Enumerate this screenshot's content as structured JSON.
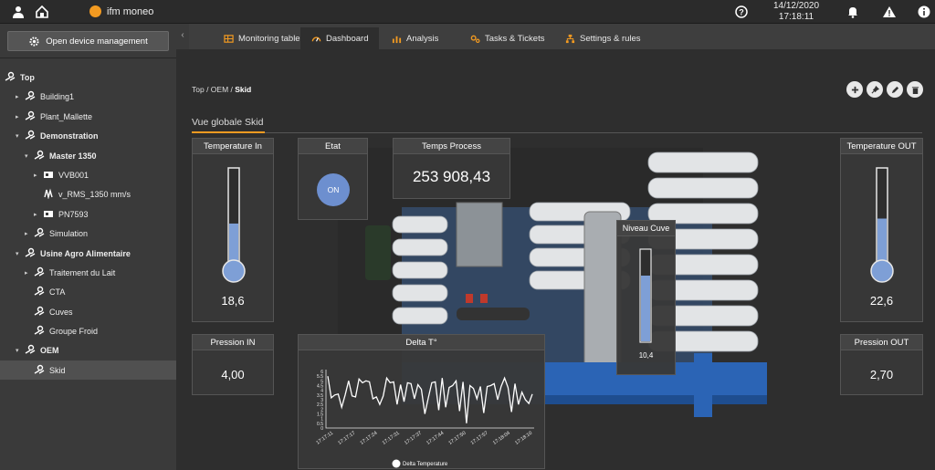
{
  "topbar": {
    "app_name": "ifm moneo",
    "date": "14/12/2020",
    "time": "17:18:11",
    "logo_color": "#f29a21"
  },
  "sidebar": {
    "device_button": "Open device management",
    "tree": [
      {
        "label": "Top",
        "level": 0,
        "caret": "",
        "bold": true,
        "icon": "sensor-group-icon"
      },
      {
        "label": "Building1",
        "level": 1,
        "caret": "▸",
        "bold": false,
        "icon": "sensor-group-icon"
      },
      {
        "label": "Plant_Mallette",
        "level": 1,
        "caret": "▸",
        "bold": false,
        "icon": "sensor-group-icon"
      },
      {
        "label": "Demonstration",
        "level": 1,
        "caret": "▾",
        "bold": true,
        "icon": "sensor-group-icon"
      },
      {
        "label": "Master 1350",
        "level": 2,
        "caret": "▾",
        "bold": true,
        "icon": "sensor-group-icon"
      },
      {
        "label": "VVB001",
        "level": 3,
        "caret": "▸",
        "bold": false,
        "icon": "device-icon"
      },
      {
        "label": "v_RMS_1350 mm/s",
        "level": 3,
        "caret": "",
        "bold": false,
        "icon": "vibration-icon"
      },
      {
        "label": "PN7593",
        "level": 3,
        "caret": "▸",
        "bold": false,
        "icon": "device-icon"
      },
      {
        "label": "Simulation",
        "level": 2,
        "caret": "▸",
        "bold": false,
        "icon": "sensor-group-icon"
      },
      {
        "label": "Usine Agro Alimentaire",
        "level": 1,
        "caret": "▾",
        "bold": true,
        "icon": "sensor-group-icon"
      },
      {
        "label": "Traitement du Lait",
        "level": 2,
        "caret": "▸",
        "bold": false,
        "icon": "sensor-group-icon"
      },
      {
        "label": "CTA",
        "level": 2,
        "caret": "",
        "bold": false,
        "icon": "sensor-group-icon"
      },
      {
        "label": "Cuves",
        "level": 2,
        "caret": "",
        "bold": false,
        "icon": "sensor-group-icon"
      },
      {
        "label": "Groupe Froid",
        "level": 2,
        "caret": "",
        "bold": false,
        "icon": "sensor-group-icon"
      },
      {
        "label": "OEM",
        "level": 1,
        "caret": "▾",
        "bold": true,
        "icon": "sensor-group-icon"
      },
      {
        "label": "Skid",
        "level": 2,
        "caret": "",
        "bold": false,
        "icon": "sensor-group-icon",
        "selected": true
      }
    ]
  },
  "tabs": [
    {
      "label": "Monitoring table",
      "icon": "table-icon",
      "active": false
    },
    {
      "label": "Dashboard",
      "icon": "gauge-icon",
      "active": true
    },
    {
      "label": "Analysis",
      "icon": "bar-chart-icon",
      "active": false
    },
    {
      "label": "Tasks & Tickets",
      "icon": "gears-icon",
      "active": false
    },
    {
      "label": "Settings & rules",
      "icon": "network-icon",
      "active": false
    }
  ],
  "breadcrumb": {
    "path": "Top / OEM / ",
    "current": "Skid"
  },
  "dashboard_title": "Vue globale Skid",
  "widgets": {
    "temp_in": {
      "title": "Temperature In",
      "value": "18,6",
      "level": 0.45
    },
    "etat": {
      "title": "Etat",
      "value": "ON",
      "color": "#6d8fcf"
    },
    "temps": {
      "title": "Temps Process",
      "value": "253 908,43"
    },
    "niveau": {
      "title": "Niveau Cuve",
      "value": "10,4",
      "level": 0.72
    },
    "temp_out": {
      "title": "Temperature OUT",
      "value": "22,6",
      "level": 0.5
    },
    "pression_in": {
      "title": "Pression IN",
      "value": "4,00"
    },
    "pression_out": {
      "title": "Pression OUT",
      "value": "2,70"
    },
    "delta": {
      "title": "Delta T°"
    }
  },
  "chart_data": {
    "type": "line",
    "title": "Delta T°",
    "x": [
      "17:17:11",
      "17:17:17",
      "17:17:24",
      "17:17:31",
      "17:17:37",
      "17:17:44",
      "17:17:50",
      "17:17:57",
      "17:18:04",
      "17:18:10"
    ],
    "yticks": [
      "0",
      "0.5",
      "1",
      "1.5",
      "2",
      "2.5",
      "3",
      "3.5",
      "4",
      "4.5",
      "5",
      "5.5",
      "6"
    ],
    "ylim": [
      0,
      6
    ],
    "series": [
      {
        "name": "Delta Temperature",
        "color": "#ffffff",
        "values": [
          5.5,
          3.2,
          3.5,
          3.6,
          2.2,
          3.5,
          5.0,
          3.4,
          3.3,
          5.2,
          4.8,
          5.0,
          4.9,
          3.1,
          3.3,
          2.5,
          3.4,
          5.3,
          4.8,
          4.9,
          2.5,
          4.6,
          2.8,
          4.8,
          4.7,
          3.1,
          4.6,
          4.1,
          1.5,
          3.2,
          4.8,
          4.9,
          1.9,
          5.3,
          2.2,
          4.3,
          4.5,
          5.0,
          1.8,
          4.9,
          0.5,
          4.5,
          4.2,
          3.1,
          4.4,
          1.6,
          4.4,
          4.5,
          4.7,
          3.0,
          4.4,
          5.3,
          4.3,
          1.7,
          4.7,
          2.5,
          3.8,
          3.0,
          2.6,
          3.6
        ]
      }
    ],
    "legend": "bottom"
  }
}
